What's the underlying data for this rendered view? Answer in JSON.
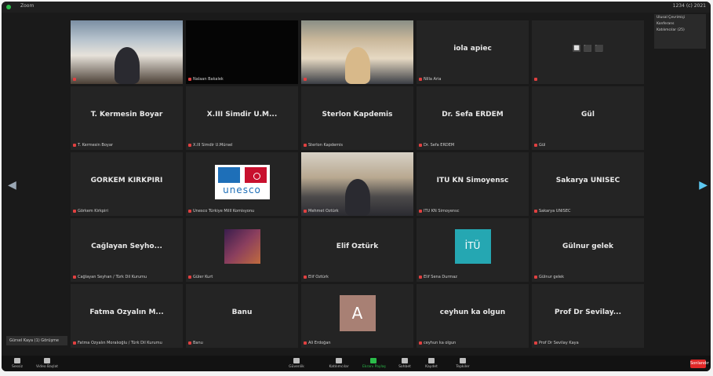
{
  "window": {
    "title": "Zoom",
    "top_right": "1234 (c) 2021"
  },
  "participants": [
    {
      "name": "",
      "caption": "",
      "type": "video",
      "style": "v1"
    },
    {
      "name": "",
      "caption": "Nalaan Bakalek",
      "type": "video",
      "style": "v2"
    },
    {
      "name": "",
      "caption": "",
      "type": "video",
      "style": "v3"
    },
    {
      "name": "iola apiec",
      "caption": "Nilla Aria",
      "type": "name"
    },
    {
      "name": "🔲 ⬛ ⬛",
      "caption": "",
      "type": "name"
    },
    {
      "name": "T. Kermesin Boyar",
      "caption": "T. Kermesin Boyar",
      "type": "name"
    },
    {
      "name": "X.III Simdir Ü.M...",
      "caption": "X.III Simdir Ü.Mürsel",
      "type": "name"
    },
    {
      "name": "Sterlon Kapdemis",
      "caption": "Sterlon Kapdemis",
      "type": "name"
    },
    {
      "name": "Dr. Sefa ERDEM",
      "caption": "Dr. Sefa ERDEM",
      "type": "name"
    },
    {
      "name": "Gül",
      "caption": "Gül",
      "type": "name"
    },
    {
      "name": "GÖRKEM KIRKPIRI",
      "caption": "Görkem Kirkpiri",
      "type": "name"
    },
    {
      "name": "",
      "caption": "Unesco Türkiye Millî Komisyonu",
      "type": "unesco",
      "unesco_word": "unesco"
    },
    {
      "name": "",
      "caption": "Mehmet Öztürk",
      "type": "video",
      "style": "v4",
      "active": true
    },
    {
      "name": "ITU KN Simoyensc",
      "caption": "ITU KN Simoyensc",
      "type": "name"
    },
    {
      "name": "Sakarya ÜNİSEC",
      "caption": "Sakarya ÜNİSEC",
      "type": "name"
    },
    {
      "name": "Cağlayan Seyho...",
      "caption": "Cağlayan Seyhan / Türk Dil Kurumu",
      "type": "name"
    },
    {
      "name": "",
      "caption": "Güler Kurt",
      "type": "thumb",
      "thumb_style": "thumb-purple"
    },
    {
      "name": "Elif Öztürk",
      "caption": "Elif Öztürk",
      "type": "name"
    },
    {
      "name": "",
      "caption": "Elif Sena Durmaz",
      "type": "thumb",
      "thumb_style": "thumb-teal",
      "thumb_text": "İTÜ"
    },
    {
      "name": "Gülnur gelek",
      "caption": "Gülnur gelek",
      "type": "name"
    },
    {
      "name": "Fatma Özyalın M...",
      "caption": "Fatma Özyalın Moralıoğlu / Türk Dil Kurumu",
      "type": "name"
    },
    {
      "name": "Banu",
      "caption": "Banu",
      "type": "name"
    },
    {
      "name": "",
      "caption": "Ali Erdoğan",
      "type": "avatar",
      "initial": "A"
    },
    {
      "name": "ceyhun ka olgun",
      "caption": "ceyhun ka olgun",
      "type": "name"
    },
    {
      "name": "Prof Dr Sevilay...",
      "caption": "Prof Dr Sevilay Kaya",
      "type": "name"
    }
  ],
  "pinned_label": "Gürsel Kaya (1) Görüşme",
  "right_panel": [
    "Ulusal Çevrimiçi",
    "Konferans",
    "Katılımcılar (25)"
  ],
  "toolbar": {
    "left": [
      {
        "label": "Sessiz"
      },
      {
        "label": "Video Başlat"
      }
    ],
    "center": [
      {
        "label": "Güvenlik"
      },
      {
        "label": "Katılımcılar"
      },
      {
        "label": "Ekranı Paylaş",
        "green": true
      },
      {
        "label": "Sohbet"
      },
      {
        "label": "Kaydet"
      },
      {
        "label": "Tepkiler"
      }
    ],
    "end_label": "Sonlandır"
  }
}
